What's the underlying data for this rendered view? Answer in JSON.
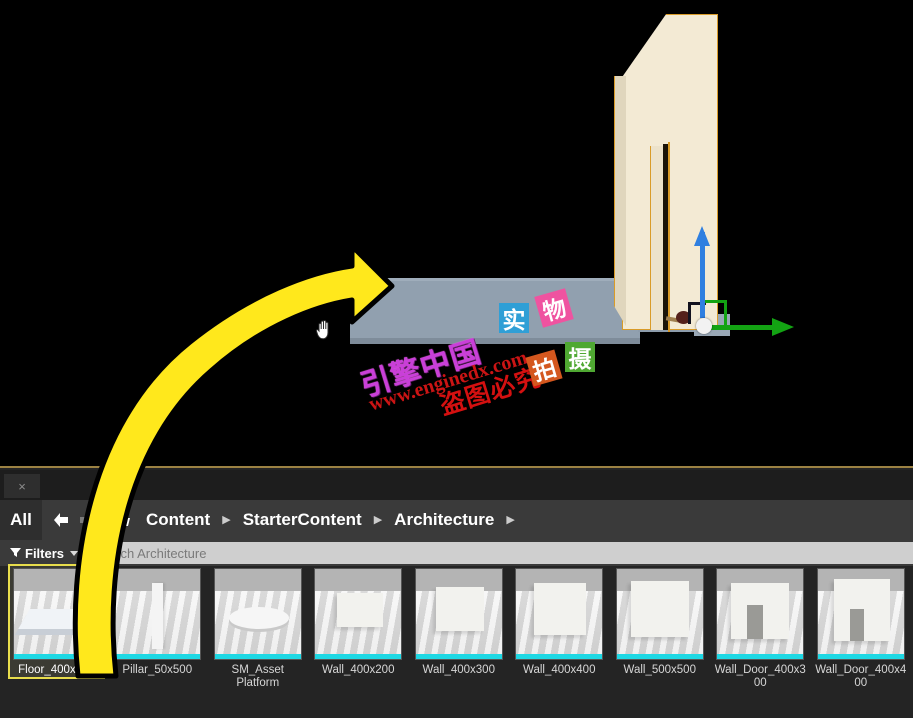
{
  "app": {
    "viewport": {
      "name": "level-viewport",
      "background_color": "#000000",
      "floor_color": "#91a0af",
      "selected_object": "Wall_Door",
      "selection_outline_color": "#d99b28",
      "gizmo": {
        "type": "translate",
        "z_axis_color": "#2f7fe0",
        "y_axis_color": "#13a313"
      },
      "cursor": "hand-cursor"
    },
    "watermark": {
      "brand": "引擎中国",
      "url": "www.enginedx.com",
      "warning": "盗图必究",
      "badges": [
        {
          "char": "实",
          "color": "#2f9fd6"
        },
        {
          "char": "物",
          "color": "#ef53a0"
        },
        {
          "char": "拍",
          "color": "#d4571e"
        },
        {
          "char": "摄",
          "color": "#4fa832"
        }
      ]
    },
    "annotation": {
      "type": "curved-arrow",
      "color": "#ffe81c",
      "outline": "#000000",
      "points_from": "Floor_400x400",
      "points_to": "viewport"
    }
  },
  "content_browser": {
    "tab": {
      "close_label": "×"
    },
    "nav": {
      "all_label": "All",
      "back_icon": "arrow-left-icon",
      "forward_icon": "arrow-right-icon",
      "folder_icon": "folder-icon"
    },
    "breadcrumbs": [
      {
        "label": "Content"
      },
      {
        "label": "StarterContent"
      },
      {
        "label": "Architecture"
      }
    ],
    "breadcrumb_separator": "▶",
    "filters": {
      "label": "Filters",
      "icon": "funnel-icon",
      "caret": "chevron-down-icon"
    },
    "search": {
      "placeholder": "Search Architecture",
      "value": ""
    },
    "assets": [
      {
        "label": "Floor_400x400",
        "shape": "floor",
        "selected": true
      },
      {
        "label": "Pillar_50x500",
        "shape": "pillar",
        "selected": false
      },
      {
        "label": "SM_Asset Platform",
        "shape": "platform",
        "selected": false
      },
      {
        "label": "Wall_400x200",
        "shape": "wall-a",
        "selected": false
      },
      {
        "label": "Wall_400x300",
        "shape": "wall-b",
        "selected": false
      },
      {
        "label": "Wall_400x400",
        "shape": "wall-c",
        "selected": false
      },
      {
        "label": "Wall_500x500",
        "shape": "wall-d",
        "selected": false
      },
      {
        "label": "Wall_Door_400x300",
        "shape": "wdoor",
        "selected": false
      },
      {
        "label": "Wall_Door_400x400",
        "shape": "wdoor2",
        "selected": false
      }
    ],
    "selection_color": "#e8dd4c",
    "thumbnail_accent_color": "#1ed8e4"
  }
}
